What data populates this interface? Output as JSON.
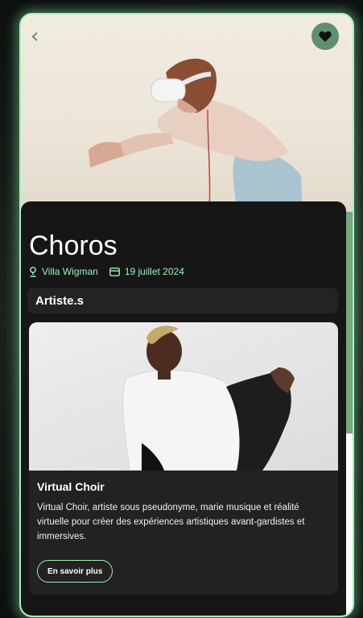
{
  "event": {
    "title": "Choros",
    "venue": "Villa Wigman",
    "date": "19 juillet 2024",
    "favorited": true
  },
  "icons": {
    "back": "chevron-left-icon",
    "favorite": "heart-icon",
    "venue": "location-pin-icon",
    "date": "ticket-icon"
  },
  "artists_section": {
    "heading": "Artiste.s",
    "artists": [
      {
        "name": "Virtual Choir",
        "description": "Virtual Choir, artiste sous pseudonyme, marie musique et réalité virtuelle pour créer des expériences artistiques avant-gardistes et immersives.",
        "button_label": "En savoir plus"
      }
    ]
  },
  "colors": {
    "accent": "#9ef0b4",
    "panel": "#161616",
    "card": "#222222",
    "favorite_bg": "#5f8f70"
  }
}
